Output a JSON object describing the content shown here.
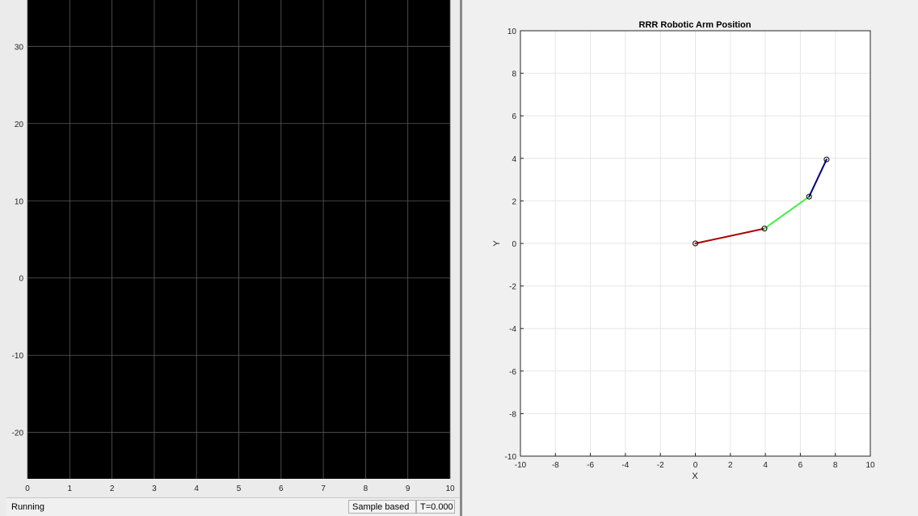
{
  "scope": {
    "status_text": "Running",
    "sample_mode": "Sample based",
    "time_readout": "T=0.000",
    "colors": {
      "background": "#000000",
      "grid": "#5a5a5a",
      "chrome": "#ebebeb"
    },
    "x_ticks": [
      "0",
      "1",
      "2",
      "3",
      "4",
      "5",
      "6",
      "7",
      "8",
      "9",
      "10"
    ],
    "y_ticks": [
      "30",
      "20",
      "10",
      "0",
      "-10",
      "-20"
    ]
  },
  "chart_data": [
    {
      "type": "line",
      "title": "",
      "xlabel": "",
      "ylabel": "",
      "xlim": [
        0,
        10
      ],
      "ylim": [
        -26,
        36
      ],
      "x_ticks": [
        0,
        1,
        2,
        3,
        4,
        5,
        6,
        7,
        8,
        9,
        10
      ],
      "y_ticks": [
        30,
        20,
        10,
        0,
        -10,
        -20
      ],
      "grid": true,
      "series": []
    },
    {
      "type": "line",
      "title": "RRR Robotic Arm Position",
      "xlabel": "X",
      "ylabel": "Y",
      "xlim": [
        -10,
        10
      ],
      "ylim": [
        -10,
        10
      ],
      "x_ticks": [
        -10,
        -8,
        -6,
        -4,
        -2,
        0,
        2,
        4,
        6,
        8,
        10
      ],
      "y_ticks": [
        10,
        8,
        6,
        4,
        2,
        0,
        -2,
        -4,
        -6,
        -8,
        -10
      ],
      "grid": true,
      "joints": [
        {
          "x": 0,
          "y": 0
        },
        {
          "x": 3.95,
          "y": 0.7
        },
        {
          "x": 6.5,
          "y": 2.2
        },
        {
          "x": 7.5,
          "y": 3.95
        }
      ],
      "links": [
        {
          "from": 0,
          "to": 1,
          "color": "#aa0000"
        },
        {
          "from": 1,
          "to": 2,
          "color": "#44ee44"
        },
        {
          "from": 2,
          "to": 3,
          "color": "#000088"
        }
      ]
    }
  ]
}
